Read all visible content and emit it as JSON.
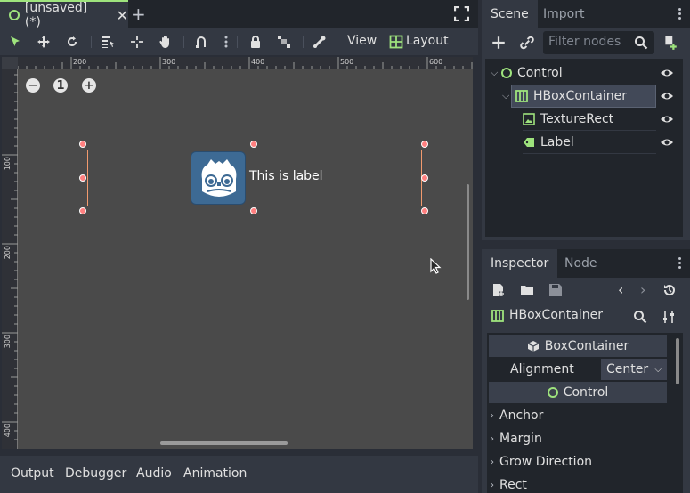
{
  "editor": {
    "tab_label": "[unsaved](*)",
    "tab_close": "✕",
    "new_tab": "+"
  },
  "toolbar": {
    "view_label": "View",
    "layout_label": "Layout"
  },
  "viewport": {
    "ruler_top_ticks": [
      "200",
      "300",
      "400",
      "500",
      "600"
    ],
    "ruler_left_ticks": [
      "100",
      "200",
      "300",
      "400"
    ],
    "zoom_out": "−",
    "zoom_reset": "1",
    "zoom_in": "+",
    "label_text": "This is label"
  },
  "bottom_panel": {
    "tabs": [
      "Output",
      "Debugger",
      "Audio",
      "Animation"
    ]
  },
  "scene_dock": {
    "tab_scene": "Scene",
    "tab_import": "Import",
    "filter_placeholder": "Filter nodes",
    "nodes": [
      {
        "name": "Control",
        "icon": "control-circle-icon",
        "color": "#9ee37d"
      },
      {
        "name": "HBoxContainer",
        "icon": "hbox-container-icon",
        "color": "#9ee37d"
      },
      {
        "name": "TextureRect",
        "icon": "texture-rect-icon",
        "color": "#9ee37d"
      },
      {
        "name": "Label",
        "icon": "label-icon",
        "color": "#9ee37d"
      }
    ]
  },
  "inspector": {
    "tab_inspector": "Inspector",
    "tab_node": "Node",
    "object_name": "HBoxContainer",
    "section_boxcontainer": "BoxContainer",
    "alignment_label": "Alignment",
    "alignment_value": "Center",
    "section_control": "Control",
    "groups": [
      "Anchor",
      "Margin",
      "Grow Direction",
      "Rect"
    ]
  },
  "colors": {
    "accent": "#9ee37d",
    "selection": "#f29a6e",
    "handle": "#ff8080",
    "panel": "#333842",
    "dark": "#21252b"
  }
}
